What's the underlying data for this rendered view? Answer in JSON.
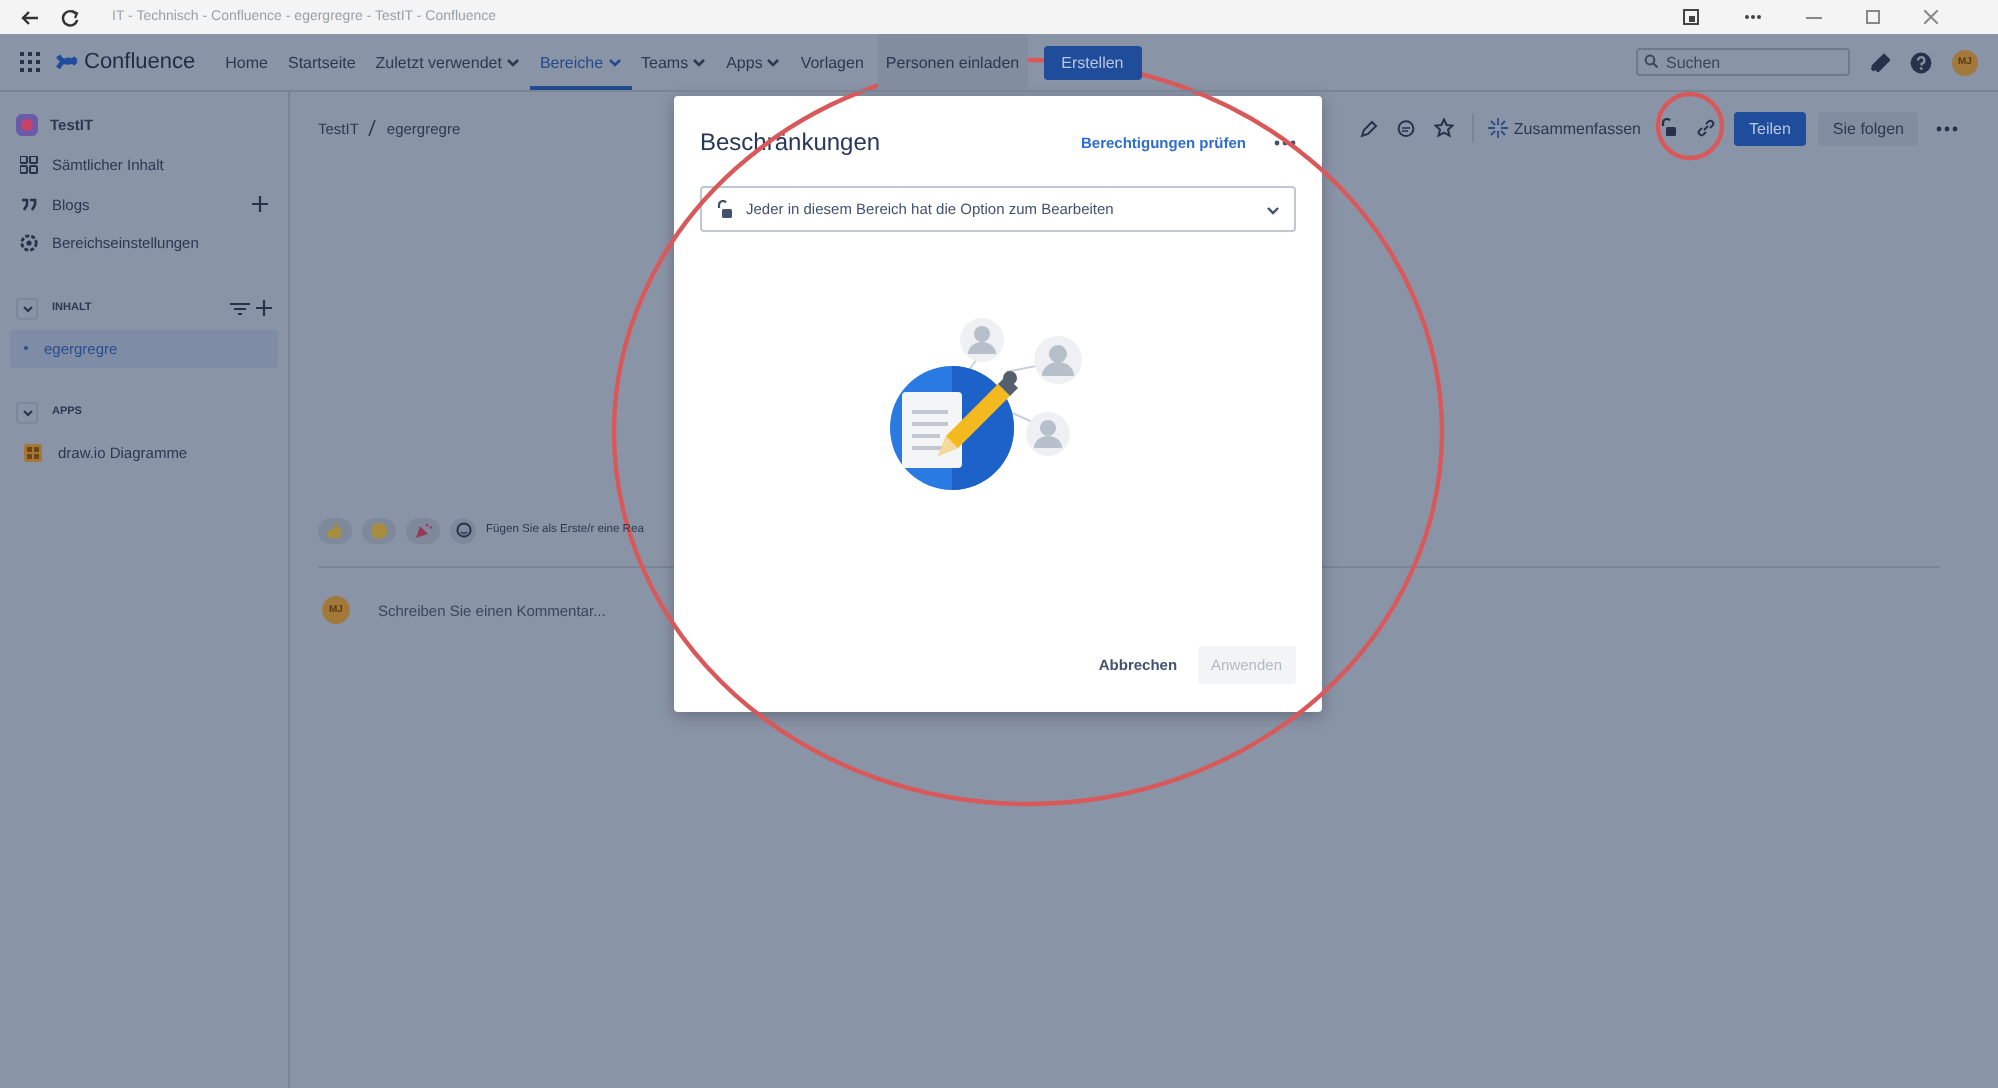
{
  "browser": {
    "title": "IT - Technisch - Confluence - egergregre - TestIT - Confluence"
  },
  "nav": {
    "logo": "Confluence",
    "items": [
      {
        "label": "Home",
        "dropdown": false,
        "selected": false
      },
      {
        "label": "Startseite",
        "dropdown": false,
        "selected": false
      },
      {
        "label": "Zuletzt verwendet",
        "dropdown": true,
        "selected": false
      },
      {
        "label": "Bereiche",
        "dropdown": true,
        "selected": true
      },
      {
        "label": "Teams",
        "dropdown": true,
        "selected": false
      },
      {
        "label": "Apps",
        "dropdown": true,
        "selected": false
      },
      {
        "label": "Vorlagen",
        "dropdown": false,
        "selected": false
      }
    ],
    "invite": "Personen einladen",
    "create": "Erstellen",
    "search": {
      "placeholder": "Suchen"
    },
    "avatar": "MJ"
  },
  "sidebar": {
    "space": "TestIT",
    "items": [
      {
        "label": "Sämtlicher Inhalt",
        "kind": "grid",
        "addable": false
      },
      {
        "label": "Blogs",
        "kind": "quote",
        "addable": true
      },
      {
        "label": "Bereichseinstellungen",
        "kind": "gear",
        "addable": false
      }
    ],
    "sections": [
      {
        "label": "INHALT",
        "expanded": true,
        "tools": true,
        "items": [
          {
            "label": "egergregre",
            "selected": true,
            "kind": "page"
          }
        ]
      },
      {
        "label": "APPS",
        "expanded": true,
        "tools": false,
        "items": [
          {
            "label": "draw.io Diagramme",
            "selected": false,
            "kind": "app"
          }
        ]
      }
    ]
  },
  "breadcrumb": [
    "TestIT",
    "egergregre"
  ],
  "toolbar": {
    "summarize": "Zusammenfassen",
    "share": "Teilen",
    "follow": "Sie folgen"
  },
  "reactions": {
    "prompt": "Fügen Sie als Erste/r eine Rea"
  },
  "comment": {
    "avatar": "MJ",
    "placeholder": "Schreiben Sie einen Kommentar..."
  },
  "modal": {
    "title": "Beschränkungen",
    "link": "Berechtigungen prüfen",
    "select": "Jeder in diesem Bereich hat die Option zum Bearbeiten",
    "buttons": [
      {
        "label": "Abbrechen",
        "disabled": false
      },
      {
        "label": "Anwenden",
        "disabled": true
      }
    ]
  }
}
